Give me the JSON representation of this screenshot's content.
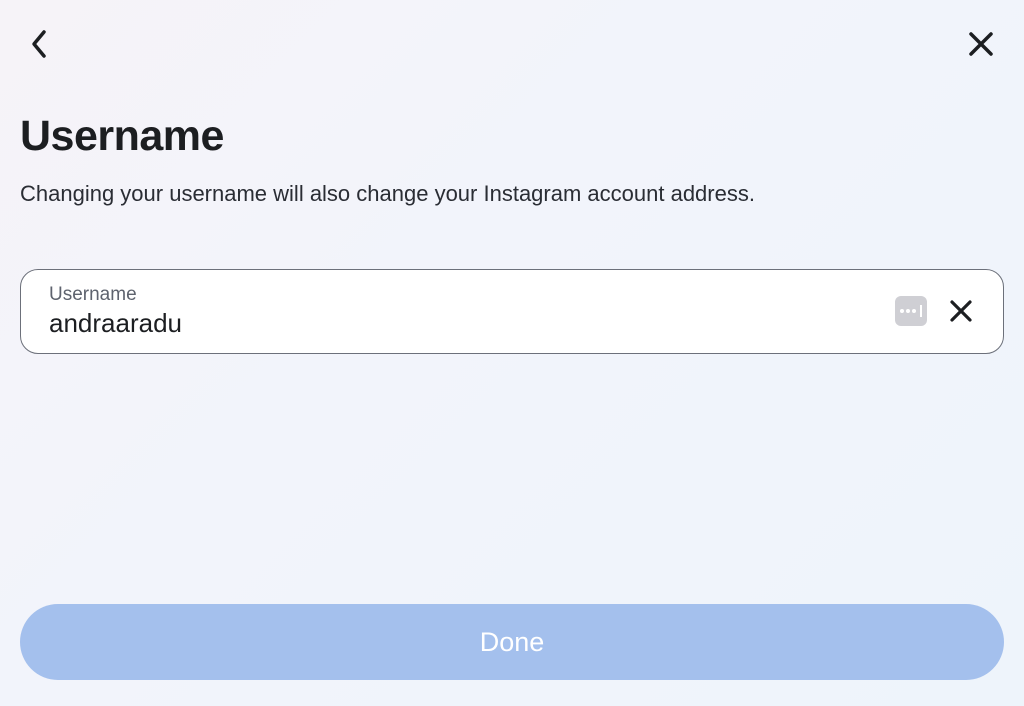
{
  "header": {
    "title": "Username",
    "subtitle": "Changing your username will also change your Instagram account address."
  },
  "field": {
    "label": "Username",
    "value": "andraaradu"
  },
  "actions": {
    "done_label": "Done"
  }
}
